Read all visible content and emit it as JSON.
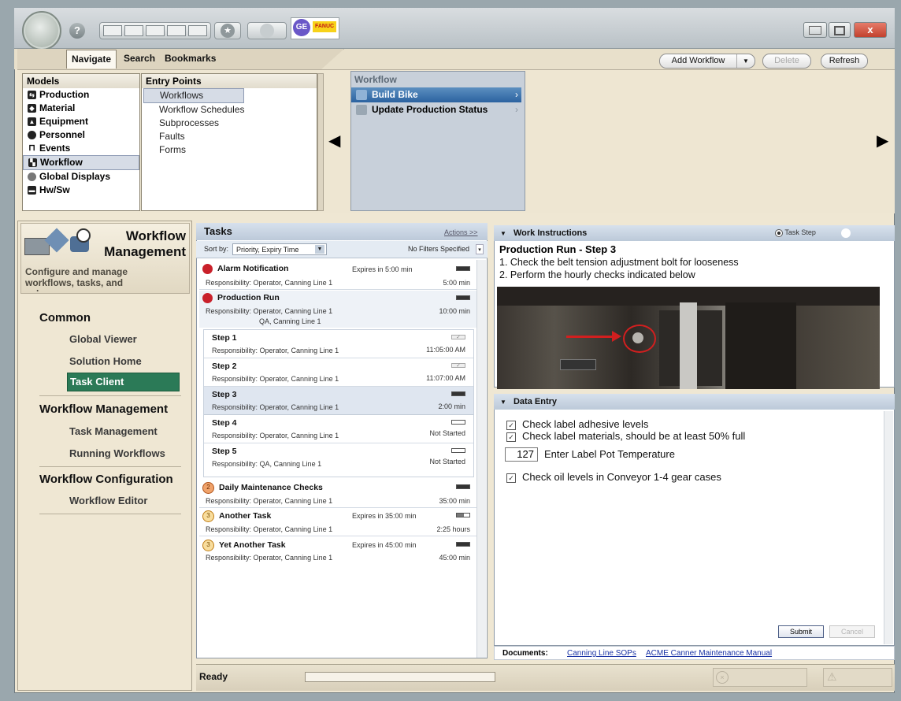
{
  "nav": {
    "tabs": [
      "Navigate",
      "Search",
      "Bookmarks"
    ],
    "add_workflow": "Add Workflow",
    "delete": "Delete",
    "refresh": "Refresh",
    "models_header": "Models",
    "models": [
      "Production",
      "Material",
      "Equipment",
      "Personnel",
      "Events",
      "Workflow",
      "Global Displays",
      "Hw/Sw"
    ],
    "entry_header": "Entry Points",
    "entry_points": [
      "Workflows",
      "Workflow Schedules",
      "Subprocesses",
      "Faults",
      "Forms"
    ],
    "workflow_header": "Workflow",
    "workflows": [
      "Build Bike",
      "Update Production Status"
    ]
  },
  "left": {
    "title_line1": "Workflow",
    "title_line2": "Management",
    "subtitle_line1": "Configure and manage",
    "subtitle_line2": "workflows, tasks, and",
    "subtitle_line3": "subprocesses",
    "common": "Common",
    "global_viewer": "Global Viewer",
    "solution_home": "Solution Home",
    "task_client": "Task Client",
    "workflow_management": "Workflow Management",
    "task_management": "Task Management",
    "running_workflows": "Running Workflows",
    "workflow_configuration": "Workflow Configuration",
    "workflow_editor": "Workflow Editor"
  },
  "tasks": {
    "title": "Tasks",
    "actions": "Actions >>",
    "sort_label": "Sort by:",
    "sort_value": "Priority, Expiry Time",
    "filter": "No Filters Specified",
    "items": [
      {
        "title": "Alarm Notification",
        "expires": "Expires in 5:00 min",
        "resp": "Responsibility:  Operator, Canning Line 1",
        "dur": "5:00 min"
      },
      {
        "title": "Production Run",
        "resp": "Responsibility:  Operator, Canning Line 1",
        "resp2": "QA, Canning Line 1",
        "dur": "10:00 min"
      },
      {
        "title": "Step 1",
        "resp": "Responsibility:  Operator, Canning Line 1",
        "dur": "11:05:00 AM"
      },
      {
        "title": "Step 2",
        "resp": "Responsibility:  Operator, Canning Line 1",
        "dur": "11:07:00 AM"
      },
      {
        "title": "Step 3",
        "resp": "Responsibility:  Operator, Canning Line 1",
        "dur": "2:00 min"
      },
      {
        "title": "Step 4",
        "resp": "Responsibility:  Operator, Canning Line 1",
        "dur": "Not Started"
      },
      {
        "title": "Step 5",
        "resp": "Responsibility:  QA, Canning Line 1",
        "dur": "Not Started"
      },
      {
        "title": "Daily Maintenance Checks",
        "num": "2",
        "resp": "Responsibility:  Operator, Canning Line 1",
        "dur": "35:00 min"
      },
      {
        "title": "Another Task",
        "num": "3",
        "expires": "Expires in 35:00 min",
        "resp": "Responsibility:  Operator, Canning Line 1",
        "dur": "2:25 hours"
      },
      {
        "title": "Yet Another Task",
        "num": "3",
        "expires": "Expires in 45:00 min",
        "resp": "Responsibility:  Operator, Canning Line 1",
        "dur": "45:00 min"
      }
    ]
  },
  "work": {
    "title": "Work Instructions",
    "task_step": "Task Step",
    "heading": "Production Run - Step 3",
    "line1": "1.  Check the belt tension adjustment bolt for looseness",
    "line2": "2.  Perform the hourly checks indicated below"
  },
  "data_entry": {
    "title": "Data Entry",
    "check1": "Check label adhesive levels",
    "check2": "Check label materials, should be at least 50% full",
    "temp_value": "127",
    "temp_label": "Enter Label Pot Temperature",
    "check3": "Check oil levels in Conveyor 1-4 gear cases",
    "submit": "Submit",
    "cancel": "Cancel"
  },
  "docs": {
    "label": "Documents:",
    "link1": "Canning Line SOPs",
    "link2": "ACME Canner Maintenance Manual"
  },
  "status": {
    "text": "Ready"
  },
  "colors": {
    "selected_blue": "#2b62a0",
    "task_client_green": "#2b7a57",
    "alarm_red": "#c9202a"
  }
}
